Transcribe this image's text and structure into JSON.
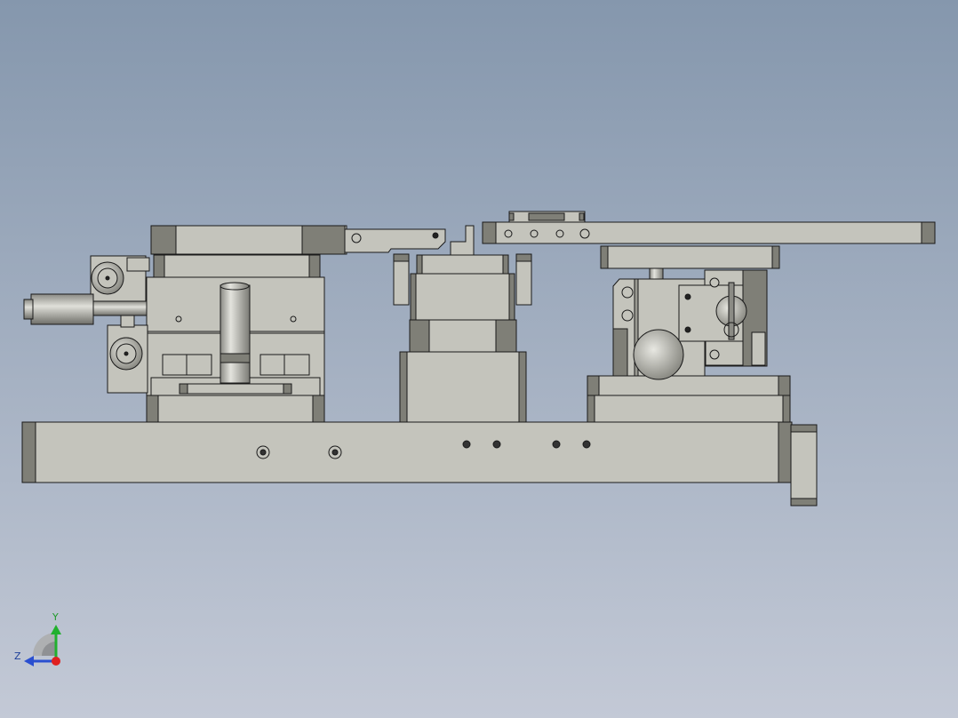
{
  "viewport": {
    "background_top": "#8597ad",
    "background_bottom": "#c3c9d6"
  },
  "model": {
    "face_color": "#c4c4bc",
    "shade_color": "#7f7f77",
    "edge_color": "#1a1a1a",
    "cylinder_color": "#c9c9c2"
  },
  "triad": {
    "y_label": "Y",
    "z_label": "Z",
    "y_color": "#22b02e",
    "z_color": "#2a4fd0",
    "x_color": "#e02020",
    "icon": "view-orientation-triad-icon"
  }
}
